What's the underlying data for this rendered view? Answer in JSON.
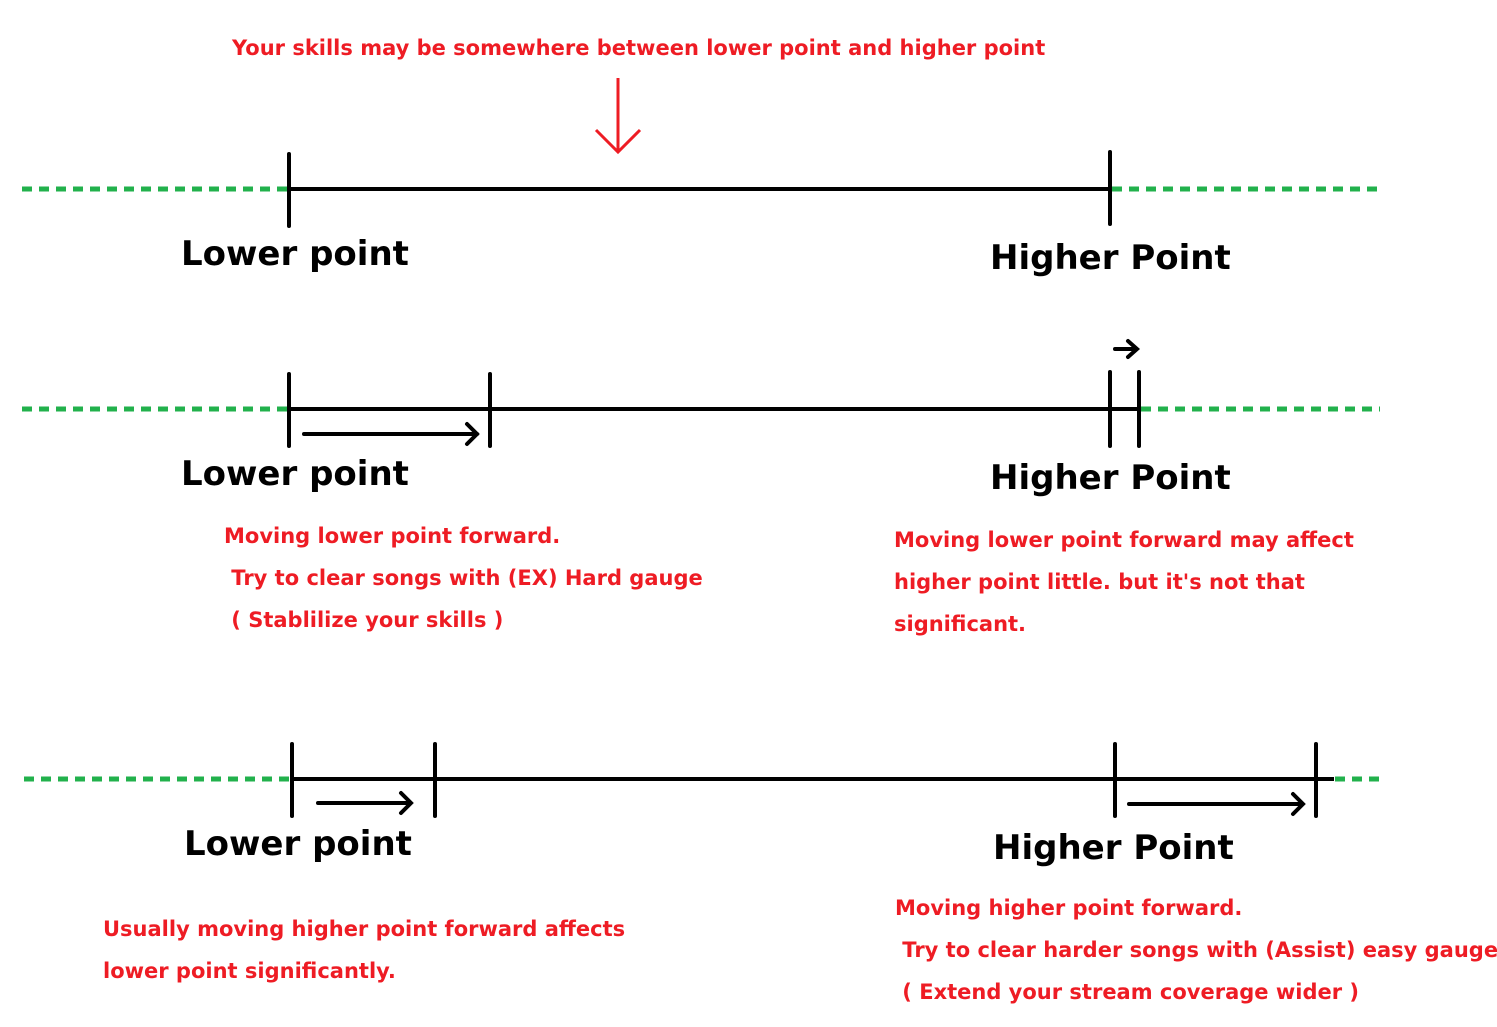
{
  "title": "Your skills may be somewhere between lower point and higher point",
  "colors": {
    "annotation": "#ee1c24",
    "line": "#000000",
    "dotted": "#22b14c",
    "background": "#ffffff"
  },
  "panels": [
    {
      "id": "current",
      "lower_label": "Lower point",
      "higher_label": "Higher Point",
      "notes_left": [],
      "notes_right": []
    },
    {
      "id": "move-lower",
      "lower_label": "Lower point",
      "higher_label": "Higher Point",
      "notes_left": [
        "Moving lower point forward.",
        " Try to clear songs with (EX) Hard gauge",
        " ( Stablilize your skills )"
      ],
      "notes_right": [
        "Moving lower point forward may affect",
        "higher point little. but it's not that",
        "significant."
      ]
    },
    {
      "id": "move-higher",
      "lower_label": "Lower point",
      "higher_label": "Higher Point",
      "notes_left": [
        "Usually moving higher point forward affects",
        "lower point significantly."
      ],
      "notes_right": [
        "Moving higher point forward.",
        " Try to clear harder songs with (Assist) easy gauge.",
        " ( Extend your stream coverage wider )"
      ]
    }
  ]
}
